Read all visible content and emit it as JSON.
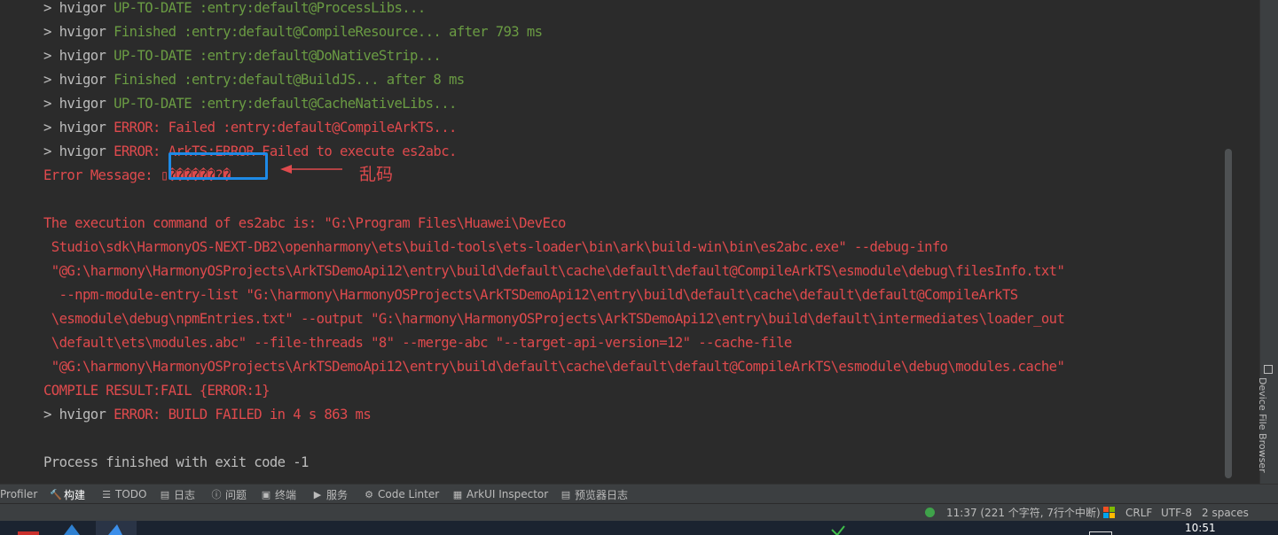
{
  "console": {
    "lines": [
      [
        {
          "t": "> hvigor ",
          "c": "w"
        },
        {
          "t": "UP-TO-DATE :entry:default@ProcessLibs...",
          "c": "g"
        }
      ],
      [
        {
          "t": "> hvigor ",
          "c": "w"
        },
        {
          "t": "Finished :entry:default@CompileResource... after 793 ms",
          "c": "g"
        }
      ],
      [
        {
          "t": "> hvigor ",
          "c": "w"
        },
        {
          "t": "UP-TO-DATE :entry:default@DoNativeStrip...",
          "c": "g"
        }
      ],
      [
        {
          "t": "> hvigor ",
          "c": "w"
        },
        {
          "t": "Finished :entry:default@BuildJS... after 8 ms",
          "c": "g"
        }
      ],
      [
        {
          "t": "> hvigor ",
          "c": "w"
        },
        {
          "t": "UP-TO-DATE :entry:default@CacheNativeLibs...",
          "c": "g"
        }
      ],
      [
        {
          "t": "> hvigor ",
          "c": "w"
        },
        {
          "t": "ERROR: Failed :entry:default@CompileArkTS...",
          "c": "r"
        }
      ],
      [
        {
          "t": "> hvigor ",
          "c": "w"
        },
        {
          "t": "ERROR: ArkTS:ERROR Failed to execute es2abc.",
          "c": "r"
        }
      ],
      [
        {
          "t": "Error Message: ",
          "c": "r"
        },
        {
          "t": "▯������?�",
          "c": "r"
        }
      ],
      [],
      [
        {
          "t": "The execution command of es2abc is: \"G:\\Program Files\\Huawei\\DevEco",
          "c": "r"
        }
      ],
      [
        {
          "t": " Studio\\sdk\\HarmonyOS-NEXT-DB2\\openharmony\\ets\\build-tools\\ets-loader\\bin\\ark\\build-win\\bin\\es2abc.exe\" --debug-info",
          "c": "r"
        }
      ],
      [
        {
          "t": " \"@G:\\harmony\\HarmonyOSProjects\\ArkTSDemoApi12\\entry\\build\\default\\cache\\default\\default@CompileArkTS\\esmodule\\debug\\filesInfo.txt\"",
          "c": "r"
        }
      ],
      [
        {
          "t": "  --npm-module-entry-list \"G:\\harmony\\HarmonyOSProjects\\ArkTSDemoApi12\\entry\\build\\default\\cache\\default\\default@CompileArkTS",
          "c": "r"
        }
      ],
      [
        {
          "t": " \\esmodule\\debug\\npmEntries.txt\" --output \"G:\\harmony\\HarmonyOSProjects\\ArkTSDemoApi12\\entry\\build\\default\\intermediates\\loader_out",
          "c": "r"
        }
      ],
      [
        {
          "t": " \\default\\ets\\modules.abc\" --file-threads \"8\" --merge-abc \"--target-api-version=12\" --cache-file",
          "c": "r"
        }
      ],
      [
        {
          "t": " \"@G:\\harmony\\HarmonyOSProjects\\ArkTSDemoApi12\\entry\\build\\default\\cache\\default\\default@CompileArkTS\\esmodule\\debug\\modules.cache\"",
          "c": "r"
        }
      ],
      [
        {
          "t": "COMPILE RESULT:FAIL {ERROR:1}",
          "c": "r"
        }
      ],
      [
        {
          "t": "> hvigor ",
          "c": "w"
        },
        {
          "t": "ERROR: BUILD FAILED in 4 s 863 ms",
          "c": "r"
        }
      ],
      [],
      [
        {
          "t": "Process finished with exit code -1",
          "c": "w"
        }
      ]
    ],
    "annotation_label": "乱码"
  },
  "right_tool_window": {
    "label": "Device File Browser"
  },
  "tool_windows": [
    {
      "label": "Profiler",
      "icon": "",
      "name": "profiler"
    },
    {
      "label": "构建",
      "icon": "🔨",
      "name": "build"
    },
    {
      "label": "TODO",
      "icon": "☰",
      "name": "todo"
    },
    {
      "label": "日志",
      "icon": "▤",
      "name": "log"
    },
    {
      "label": "问题",
      "icon": "ⓘ",
      "name": "problems"
    },
    {
      "label": "终端",
      "icon": "▣",
      "name": "terminal"
    },
    {
      "label": "服务",
      "icon": "▶",
      "name": "services"
    },
    {
      "label": "Code Linter",
      "icon": "⚙",
      "name": "code-linter"
    },
    {
      "label": "ArkUI Inspector",
      "icon": "▦",
      "name": "arkui-inspector"
    },
    {
      "label": "预览器日志",
      "icon": "▤",
      "name": "previewer-log"
    }
  ],
  "status": {
    "position": "11:37 (221 个字符, 7行个中断)",
    "line_separator": "CRLF",
    "encoding": "UTF-8",
    "indent": "2 spaces"
  },
  "taskbar": {
    "time": "10:51"
  },
  "colors": {
    "green": "#6a9b43",
    "red": "#df4a4d",
    "annotation": "#1e8ae6"
  }
}
